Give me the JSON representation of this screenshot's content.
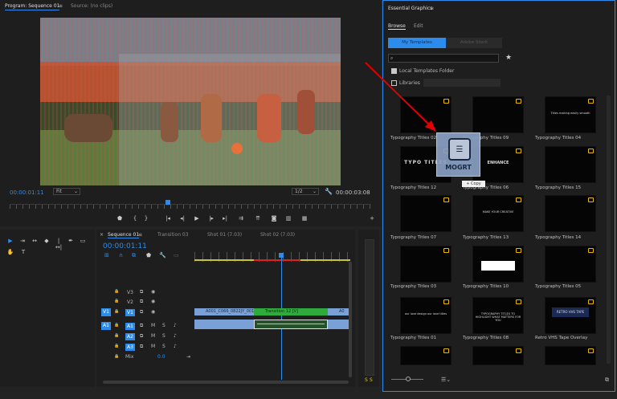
{
  "program_tabs": {
    "program": "Program: Sequence 01",
    "menu": "≡",
    "source": "Source: (no clips)"
  },
  "monitor": {
    "timecode_left": "00:00:01:11",
    "fit": "Fit",
    "quality": "1/2",
    "timecode_right": "00:00:03:08"
  },
  "transport_icons": [
    "marker-icon",
    "in-icon",
    "out-icon",
    "go-to-in-icon",
    "step-back-icon",
    "play-icon",
    "step-forward-icon",
    "go-to-out-icon",
    "insert-icon",
    "overwrite-icon",
    "export-frame-icon",
    "compare-icon",
    "add-icon"
  ],
  "transport_glyphs": [
    "⬟",
    "{",
    "}",
    "|◂",
    "◂|",
    "▶",
    "|▸",
    "▸|",
    "⇉",
    "⇈",
    "◙",
    "▥",
    "▦",
    "+"
  ],
  "sequence": {
    "close": "×",
    "tab": "Sequence 01",
    "menu": "≡",
    "other_tabs": [
      "Transition 03",
      "Shot 01 (7.03)",
      "Shot 02 (7.03)"
    ],
    "timecode": "00:00:01:11"
  },
  "tracks": {
    "video": [
      {
        "lock": "🔒",
        "name": "V3"
      },
      {
        "lock": "🔒",
        "name": "V2"
      },
      {
        "lock": "🔒",
        "name": "V1",
        "src": "V1"
      }
    ],
    "audio": [
      {
        "lock": "🔒",
        "name": "A1",
        "src": "A1",
        "m": "M",
        "s": "S"
      },
      {
        "lock": "🔒",
        "name": "A2",
        "m": "M",
        "s": "S"
      },
      {
        "lock": "🔒",
        "name": "A3",
        "m": "M",
        "s": "S"
      }
    ],
    "mix": {
      "label": "Mix",
      "value": "0.0"
    }
  },
  "clips": {
    "clip1": "A001_C066_0822JY_001",
    "clip2": "Transition 12 [V]",
    "clip3": "A0"
  },
  "tools": [
    "selection-icon",
    "track-select-icon",
    "ripple-edit-icon",
    "razor-icon",
    "slip-icon",
    "pen-icon",
    "rectangle-icon",
    "hand-icon",
    "type-icon"
  ],
  "tool_glyphs": [
    "▶",
    "⇥",
    "↔",
    "◆",
    "|↔|",
    "✒",
    "▭",
    "✋",
    "T"
  ],
  "essential_graphics": {
    "title": "Essential Graphics",
    "menu": "≡",
    "tabs": [
      "Browse",
      "Edit"
    ],
    "my_templates": "My Templates",
    "adobe_stock": "Adobe Stock",
    "search_placeholder": "",
    "local_folder": "Local Templates Folder",
    "libraries": "Libraries",
    "templates": [
      {
        "label": "Typography Titles 02",
        "text": ""
      },
      {
        "label": "Typography Titles 09",
        "text": ""
      },
      {
        "label": "Typography Titles 04",
        "text": "Titles making easily smooth"
      },
      {
        "label": "Typography Titles 12",
        "text": "TYPO TITLES"
      },
      {
        "label": "Typography Titles 06",
        "text": "ENHANCE"
      },
      {
        "label": "Typography Titles 15",
        "text": ""
      },
      {
        "label": "Typography Titles 07",
        "text": ""
      },
      {
        "label": "Typography Titles 13",
        "text": "MAKE YOUR CREATIVE"
      },
      {
        "label": "Typography Titles 14",
        "text": ""
      },
      {
        "label": "Typography Titles 03",
        "text": ""
      },
      {
        "label": "Typography Titles 10",
        "text": ""
      },
      {
        "label": "Typography Titles 05",
        "text": ""
      },
      {
        "label": "Typography Titles 01",
        "text": "our love design our love titles"
      },
      {
        "label": "Typography Titles 08",
        "text": "TYPOGRAPHY TITLES TO HIGHLIGHT WHAT MATTERS FOR YOU"
      },
      {
        "label": "Retro VHS Tape Overlay",
        "text": "RETRO VHS TAPE"
      }
    ],
    "drag_badge": "MOGRT",
    "copy_tooltip": "+ Copy"
  },
  "audio_meter": {
    "labels": [
      "S",
      "S"
    ]
  },
  "colors": {
    "accent": "#2d8ceb",
    "timeline_clip": "#7aa0d8",
    "transition_clip": "#2faa3c",
    "red_arrow": "#e10000",
    "star": "#e9b800"
  }
}
